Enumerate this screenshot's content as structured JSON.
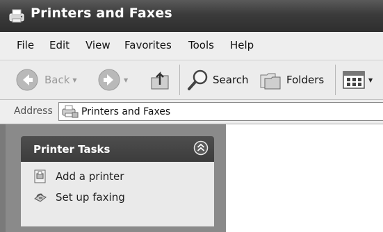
{
  "window": {
    "title": "Printers and Faxes"
  },
  "menu": [
    "File",
    "Edit",
    "View",
    "Favorites",
    "Tools",
    "Help"
  ],
  "toolbar": {
    "back_label": "Back",
    "search_label": "Search",
    "folders_label": "Folders"
  },
  "address": {
    "label": "Address",
    "value": "Printers and Faxes"
  },
  "task_pane": {
    "title": "Printer Tasks",
    "items": [
      {
        "label": "Add a printer",
        "icon": "add-printer-icon"
      },
      {
        "label": "Set up faxing",
        "icon": "fax-icon"
      }
    ]
  }
}
